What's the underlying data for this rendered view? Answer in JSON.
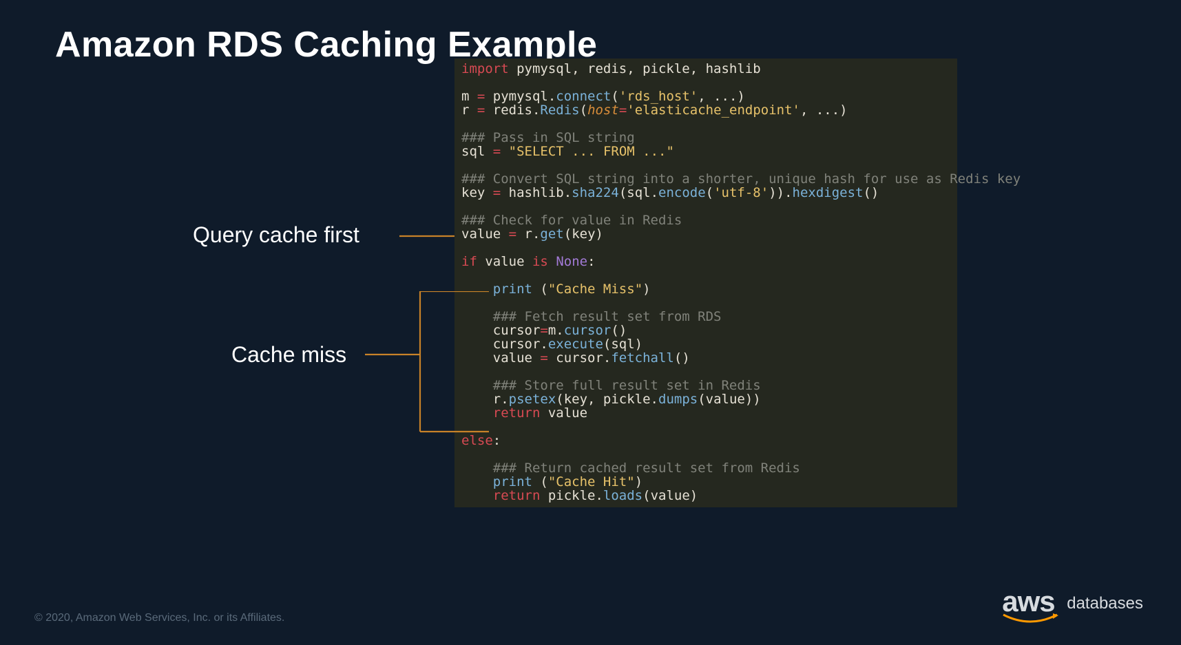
{
  "title": "Amazon RDS Caching Example",
  "annotations": {
    "query_cache_first": "Query cache first",
    "cache_miss": "Cache miss"
  },
  "code": {
    "l01_a": "import",
    "l01_b": " pymysql, redis, pickle, hashlib",
    "l03_a": "m ",
    "l03_b": "=",
    "l03_c": " pymysql.",
    "l03_d": "connect",
    "l03_e": "(",
    "l03_f": "'rds_host'",
    "l03_g": ", ...)",
    "l04_a": "r ",
    "l04_b": "=",
    "l04_c": " redis.",
    "l04_d": "Redis",
    "l04_e": "(",
    "l04_f": "host",
    "l04_g": "=",
    "l04_h": "'elasticache_endpoint'",
    "l04_i": ", ...)",
    "l06": "### Pass in SQL string",
    "l07_a": "sql ",
    "l07_b": "=",
    "l07_c": " ",
    "l07_d": "\"SELECT ... FROM ...\"",
    "l09": "### Convert SQL string into a shorter, unique hash for use as Redis key",
    "l10_a": "key ",
    "l10_b": "=",
    "l10_c": " hashlib.",
    "l10_d": "sha224",
    "l10_e": "(sql.",
    "l10_f": "encode",
    "l10_g": "(",
    "l10_h": "'utf-8'",
    "l10_i": ")).",
    "l10_j": "hexdigest",
    "l10_k": "()",
    "l12": "### Check for value in Redis",
    "l13_a": "value ",
    "l13_b": "=",
    "l13_c": " r.",
    "l13_d": "get",
    "l13_e": "(key)",
    "l15_a": "if",
    "l15_b": " value ",
    "l15_c": "is",
    "l15_d": " ",
    "l15_e": "None",
    "l15_f": ":",
    "l17_a": "    ",
    "l17_b": "print",
    "l17_c": " (",
    "l17_d": "\"Cache Miss\"",
    "l17_e": ")",
    "l19": "    ### Fetch result set from RDS",
    "l20_a": "    cursor",
    "l20_b": "=",
    "l20_c": "m.",
    "l20_d": "cursor",
    "l20_e": "()",
    "l21_a": "    cursor.",
    "l21_b": "execute",
    "l21_c": "(sql)",
    "l22_a": "    value ",
    "l22_b": "=",
    "l22_c": " cursor.",
    "l22_d": "fetchall",
    "l22_e": "()",
    "l24": "    ### Store full result set in Redis",
    "l25_a": "    r.",
    "l25_b": "psetex",
    "l25_c": "(key, pickle.",
    "l25_d": "dumps",
    "l25_e": "(value))",
    "l26_a": "    ",
    "l26_b": "return",
    "l26_c": " value",
    "l28_a": "else",
    "l28_b": ":",
    "l30": "    ### Return cached result set from Redis",
    "l31_a": "    ",
    "l31_b": "print",
    "l31_c": " (",
    "l31_d": "\"Cache Hit\"",
    "l31_e": ")",
    "l32_a": "    ",
    "l32_b": "return",
    "l32_c": " pickle.",
    "l32_d": "loads",
    "l32_e": "(value)"
  },
  "footer": "© 2020, Amazon Web Services, Inc. or its Affiliates.",
  "logo": {
    "text": "aws",
    "sub": "databases"
  }
}
